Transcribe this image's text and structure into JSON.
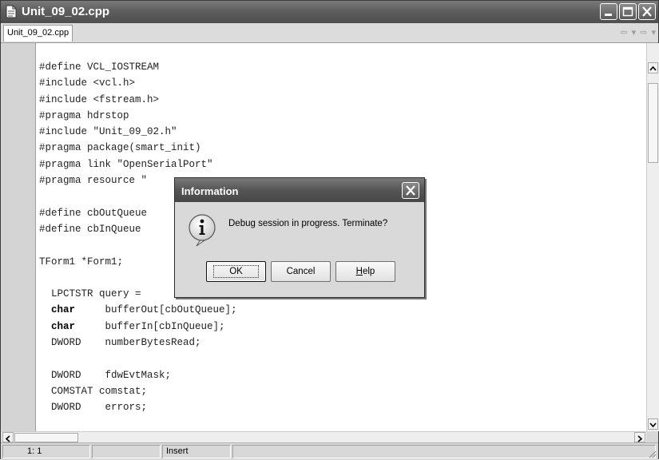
{
  "window": {
    "title": "Unit_09_02.cpp"
  },
  "tabs": [
    {
      "label": "Unit_09_02.cpp"
    }
  ],
  "nav": {
    "back_icon": "back-arrow-icon",
    "forward_icon": "forward-arrow-icon",
    "arrows_text": "⇦ ▾ ⇨ ▾"
  },
  "code_lines": [
    "#define VCL_IOSTREAM",
    "#include <vcl.h>",
    "#include <fstream.h>",
    "#pragma hdrstop",
    "#include \"Unit_09_02.h\"",
    "#pragma package(smart_init)",
    "#pragma link \"OpenSerialPort\"",
    "#pragma resource \"",
    "",
    "#define cbOutQueue",
    "#define cbInQueue",
    "",
    "TForm1 *Form1;",
    "",
    "  LPCTSTR query =",
    "  char     bufferOut[cbOutQueue];",
    "  char     bufferIn[cbInQueue];",
    "  DWORD    numberBytesRead;",
    "",
    "  DWORD    fdwEvtMask;",
    "  COMSTAT comstat;",
    "  DWORD    errors;"
  ],
  "status": {
    "position": "1:  1",
    "mode": "Insert"
  },
  "dialog": {
    "title": "Information",
    "message": "Debug session in progress. Terminate?",
    "icon": "information-icon",
    "buttons": {
      "ok": "OK",
      "cancel": "Cancel",
      "help_prefix": "H",
      "help_rest": "elp"
    }
  },
  "colors": {
    "titlebar": "#5e5e5e",
    "gutter": "#d4d4d4",
    "dialog_bg": "#d9d9d9"
  }
}
